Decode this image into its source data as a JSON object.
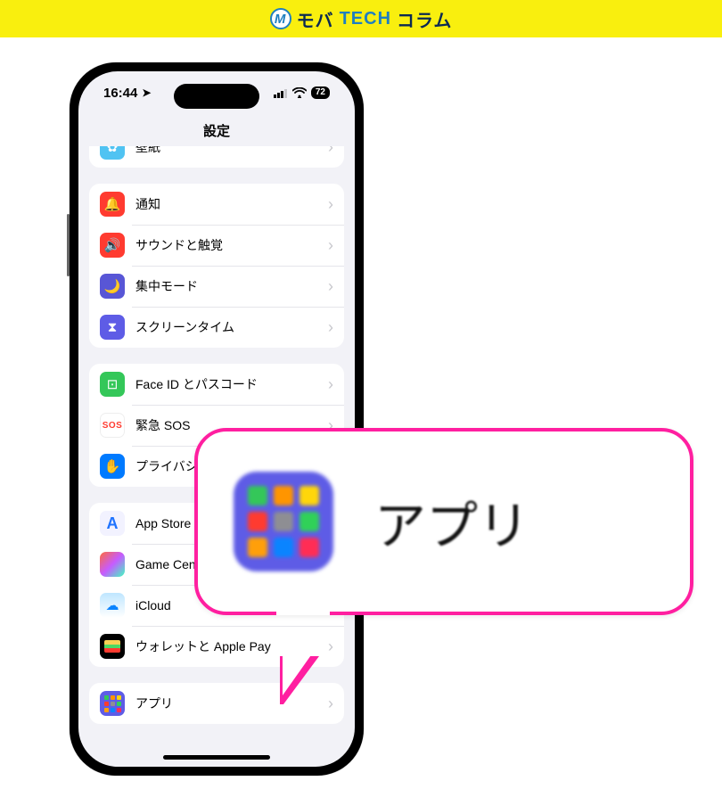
{
  "brand": {
    "seg1": "モバ",
    "seg2": "TECH",
    "seg3": "コラム",
    "logo_letter": "M"
  },
  "status": {
    "time": "16:44",
    "battery": "72"
  },
  "nav_title": "設定",
  "groups": [
    {
      "rows": [
        {
          "key": "wallpaper",
          "label": "壁紙",
          "tile": "t-wallpaper",
          "icon": "✿"
        }
      ]
    },
    {
      "rows": [
        {
          "key": "notifications",
          "label": "通知",
          "tile": "t-red",
          "icon": "🔔"
        },
        {
          "key": "sounds",
          "label": "サウンドと触覚",
          "tile": "t-red",
          "icon": "🔊"
        },
        {
          "key": "focus",
          "label": "集中モード",
          "tile": "t-indigo",
          "icon": "🌙"
        },
        {
          "key": "screentime",
          "label": "スクリーンタイム",
          "tile": "t-purple",
          "icon": "⧗"
        }
      ]
    },
    {
      "rows": [
        {
          "key": "faceid",
          "label": "Face ID とパスコード",
          "tile": "t-green",
          "icon": "⊡"
        },
        {
          "key": "sos",
          "label": "緊急 SOS",
          "tile": "t-white",
          "icon": "SOS"
        },
        {
          "key": "privacy",
          "label": "プライバシーとセキュリティ",
          "tile": "t-hand",
          "icon": "✋"
        }
      ]
    },
    {
      "rows": [
        {
          "key": "appstore",
          "label": "App Store",
          "tile": "t-astore",
          "icon": "A"
        },
        {
          "key": "gamecenter",
          "label": "Game Center",
          "tile": "t-gc",
          "icon": ""
        },
        {
          "key": "icloud",
          "label": "iCloud",
          "tile": "t-icloud",
          "icon": "☁"
        },
        {
          "key": "wallet",
          "label": "ウォレットと Apple Pay",
          "tile": "t-wallet",
          "icon": "wallet"
        }
      ]
    },
    {
      "rows": [
        {
          "key": "apps",
          "label": "アプリ",
          "tile": "t-apps",
          "icon": "apps"
        }
      ]
    }
  ],
  "callout_label": "アプリ"
}
